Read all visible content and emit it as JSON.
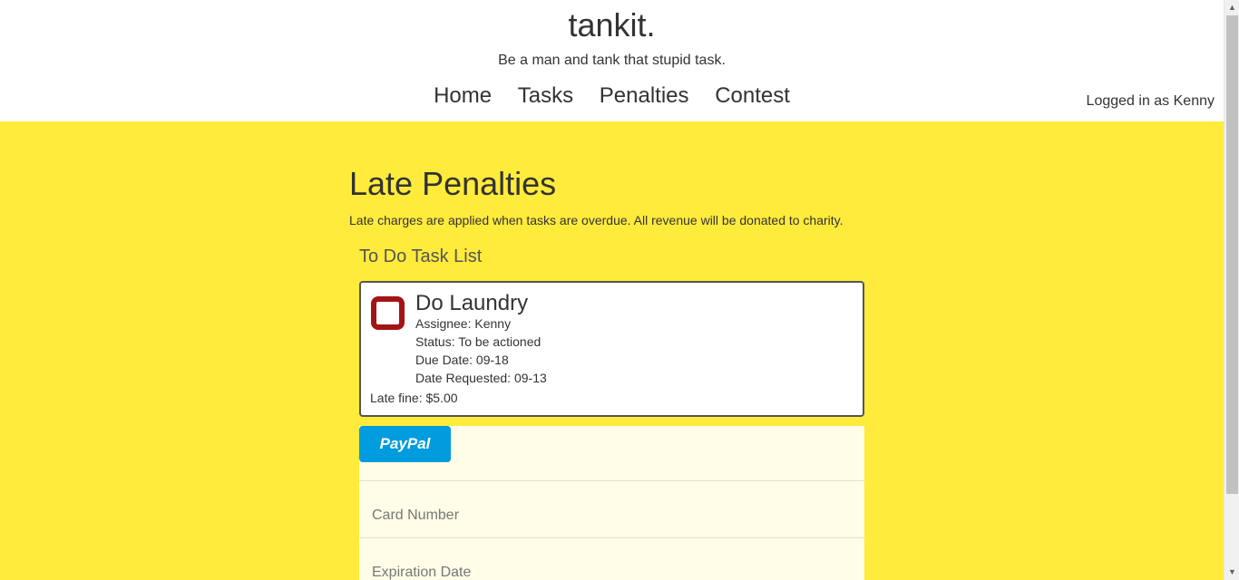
{
  "header": {
    "brand": "tankit.",
    "tagline": "Be a man and tank that stupid task.",
    "nav": [
      "Home",
      "Tasks",
      "Penalties",
      "Contest"
    ],
    "login_status": "Logged in as Kenny"
  },
  "main": {
    "title": "Late Penalties",
    "description": "Late charges are applied when tasks are overdue. All revenue will be donated to charity.",
    "section_title": "To Do Task List",
    "task": {
      "title": "Do Laundry",
      "assignee": "Assignee: Kenny",
      "status": "Status: To be actioned",
      "due_date": "Due Date: 09-18",
      "date_requested": "Date Requested: 09-13",
      "late_fine": "Late fine: $5.00"
    }
  },
  "payment": {
    "paypal_label": "PayPal",
    "card_number_placeholder": "Card Number",
    "expiration_placeholder": "Expiration Date"
  },
  "colors": {
    "page_bg": "#ffeb3b",
    "checkbox_border": "#a31515",
    "paypal_blue": "#009cde",
    "pay_panel_bg": "#fffde7"
  }
}
